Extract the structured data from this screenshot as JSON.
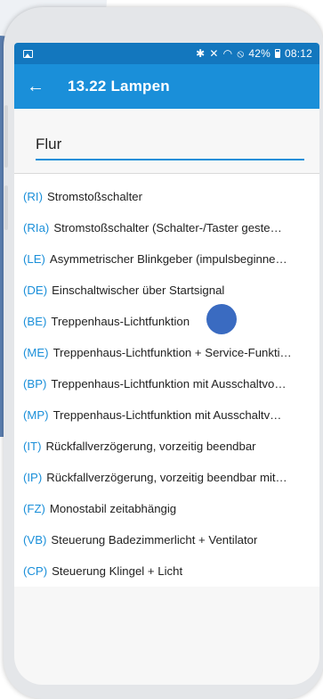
{
  "status_bar": {
    "icons": [
      "image-icon",
      "bluetooth-icon",
      "mute-icon",
      "wifi-icon",
      "no-sim-icon",
      "battery-icon"
    ],
    "battery": "42%",
    "time": "08:12"
  },
  "app_bar": {
    "back_icon": "arrow-left-icon",
    "title": "13.22 Lampen"
  },
  "search": {
    "value": "Flur"
  },
  "items": [
    {
      "code": "(RI)",
      "label": "Stromstoßschalter"
    },
    {
      "code": "(RIa)",
      "label": "Stromstoßschalter (Schalter-/Taster geste…"
    },
    {
      "code": "(LE)",
      "label": "Asymmetrischer Blinkgeber (impulsbeginne…"
    },
    {
      "code": "(DE)",
      "label": "Einschaltwischer über Startsignal"
    },
    {
      "code": "(BE)",
      "label": "Treppenhaus-Lichtfunktion"
    },
    {
      "code": "(ME)",
      "label": "Treppenhaus-Lichtfunktion + Service-Funkti…"
    },
    {
      "code": "(BP)",
      "label": "Treppenhaus-Lichtfunktion mit Ausschaltvo…"
    },
    {
      "code": "(MP)",
      "label": "Treppenhaus-Lichtfunktion mit Ausschaltv…"
    },
    {
      "code": "(IT)",
      "label": "Rückfallverzögerung, vorzeitig beendbar"
    },
    {
      "code": "(IP)",
      "label": "Rückfallverzögerung, vorzeitig beendbar mit…"
    },
    {
      "code": "(FZ)",
      "label": "Monostabil zeitabhängig"
    },
    {
      "code": "(VB)",
      "label": "Steuerung Badezimmerlicht + Ventilator"
    },
    {
      "code": "(CP)",
      "label": "Steuerung Klingel + Licht"
    }
  ],
  "colors": {
    "status_bar": "#1377be",
    "app_bar": "#1a8fd9",
    "accent": "#1a8fd9",
    "touch_indicator": "#3a6bc1"
  }
}
